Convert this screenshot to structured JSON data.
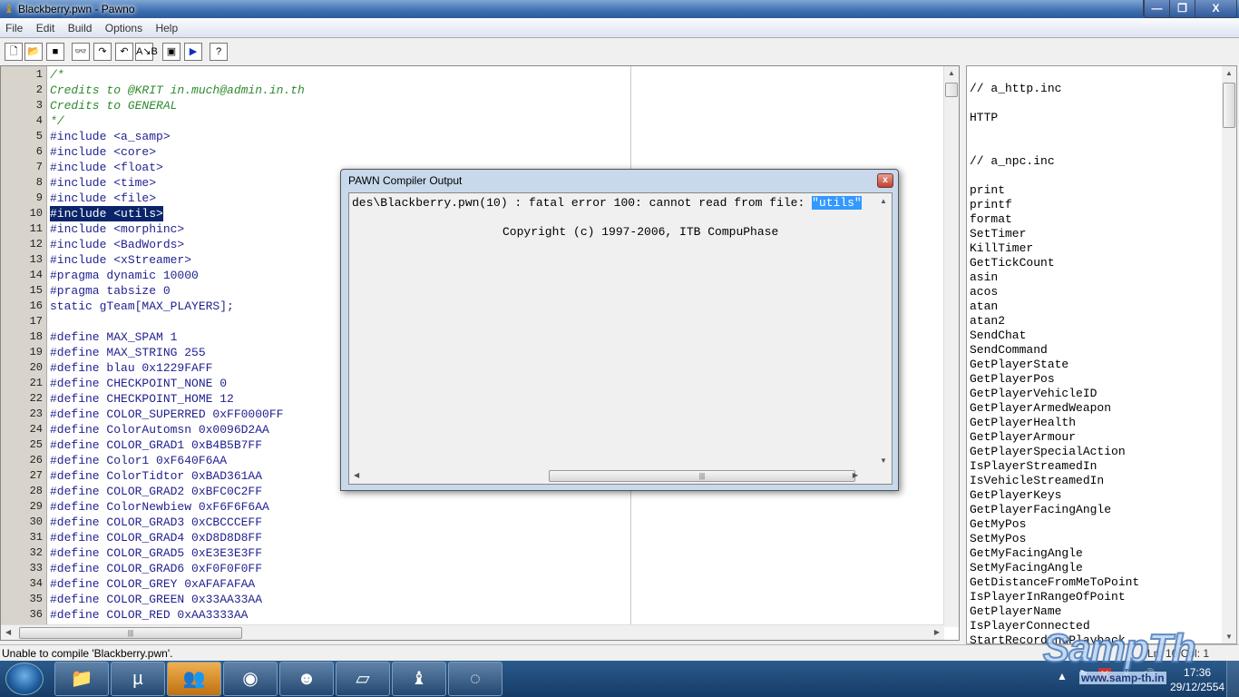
{
  "window": {
    "title": "Blackberry.pwn - Pawno",
    "minimize": "—",
    "maximize": "❐",
    "close": "X"
  },
  "menu": [
    "File",
    "Edit",
    "Build",
    "Options",
    "Help"
  ],
  "toolbar": [
    {
      "name": "new-file",
      "glyph": "🗋"
    },
    {
      "name": "open-file",
      "glyph": "📂"
    },
    {
      "name": "save-file",
      "glyph": "■"
    },
    {
      "name": "find",
      "glyph": "👓"
    },
    {
      "name": "find-next",
      "glyph": "↷"
    },
    {
      "name": "find-prev",
      "glyph": "↶"
    },
    {
      "name": "replace",
      "glyph": "A↘B"
    },
    {
      "name": "compile-window",
      "glyph": "▣"
    },
    {
      "name": "compile-run",
      "glyph": "▶"
    },
    {
      "name": "help",
      "glyph": "?"
    }
  ],
  "editor": {
    "selected_line": 10,
    "lines": [
      {
        "t": "/*",
        "c": "comment"
      },
      {
        "t": "Credits to @KRIT in.much@admin.in.th",
        "c": "comment"
      },
      {
        "t": "Credits to GENERAL",
        "c": "comment"
      },
      {
        "t": "*/",
        "c": "comment"
      },
      {
        "t": "#include <a_samp>"
      },
      {
        "t": "#include <core>"
      },
      {
        "t": "#include <float>"
      },
      {
        "t": "#include <time>"
      },
      {
        "t": "#include <file>"
      },
      {
        "t": "#include <utils>"
      },
      {
        "t": "#include <morphinc>"
      },
      {
        "t": "#include <BadWords>"
      },
      {
        "t": "#include <xStreamer>"
      },
      {
        "t": "#pragma dynamic 10000"
      },
      {
        "t": "#pragma tabsize 0"
      },
      {
        "t": "static gTeam[MAX_PLAYERS];"
      },
      {
        "t": ""
      },
      {
        "t": "#define MAX_SPAM 1"
      },
      {
        "t": "#define MAX_STRING 255"
      },
      {
        "t": "#define blau 0x1229FAFF"
      },
      {
        "t": "#define CHECKPOINT_NONE 0"
      },
      {
        "t": "#define CHECKPOINT_HOME 12"
      },
      {
        "t": "#define COLOR_SUPERRED 0xFF0000FF"
      },
      {
        "t": "#define ColorAutomsn 0x0096D2AA"
      },
      {
        "t": "#define COLOR_GRAD1 0xB4B5B7FF"
      },
      {
        "t": "#define Color1 0xF640F6AA"
      },
      {
        "t": "#define ColorTidtor 0xBAD361AA"
      },
      {
        "t": "#define COLOR_GRAD2 0xBFC0C2FF"
      },
      {
        "t": "#define ColorNewbiew 0xF6F6F6AA"
      },
      {
        "t": "#define COLOR_GRAD3 0xCBCCCEFF"
      },
      {
        "t": "#define COLOR_GRAD4 0xD8D8D8FF"
      },
      {
        "t": "#define COLOR_GRAD5 0xE3E3E3FF"
      },
      {
        "t": "#define COLOR_GRAD6 0xF0F0F0FF"
      },
      {
        "t": "#define COLOR_GREY 0xAFAFAFAA"
      },
      {
        "t": "#define COLOR_GREEN 0x33AA33AA"
      },
      {
        "t": "#define COLOR_RED 0xAA3333AA"
      }
    ]
  },
  "functions_panel": [
    "",
    "// a_http.inc",
    "",
    "HTTP",
    "",
    "",
    "// a_npc.inc",
    "",
    "print",
    "printf",
    "format",
    "SetTimer",
    "KillTimer",
    "GetTickCount",
    "asin",
    "acos",
    "atan",
    "atan2",
    "SendChat",
    "SendCommand",
    "GetPlayerState",
    "GetPlayerPos",
    "GetPlayerVehicleID",
    "GetPlayerArmedWeapon",
    "GetPlayerHealth",
    "GetPlayerArmour",
    "GetPlayerSpecialAction",
    "IsPlayerStreamedIn",
    "IsVehicleStreamedIn",
    "GetPlayerKeys",
    "GetPlayerFacingAngle",
    "GetMyPos",
    "SetMyPos",
    "GetMyFacingAngle",
    "SetMyFacingAngle",
    "GetDistanceFromMeToPoint",
    "IsPlayerInRangeOfPoint",
    "GetPlayerName",
    "IsPlayerConnected",
    "StartRecordingPlayback"
  ],
  "dialog": {
    "title": "PAWN Compiler Output",
    "error_prefix": "des\\Blackberry.pwn(10) : fatal error 100: cannot read from file: ",
    "error_highlight": "\"utils\"",
    "copyright": "Copyright (c) 1997-2006, ITB CompuPhase"
  },
  "status": {
    "message": "Unable to compile 'Blackberry.pwn'.",
    "position": "Ln: 10   Col: 1"
  },
  "taskbar": {
    "apps": [
      {
        "name": "explorer",
        "glyph": "📁"
      },
      {
        "name": "utorrent",
        "glyph": "µ"
      },
      {
        "name": "messenger",
        "glyph": "👥",
        "active": true
      },
      {
        "name": "chrome",
        "glyph": "◉"
      },
      {
        "name": "camfrog",
        "glyph": "☻"
      },
      {
        "name": "notepad",
        "glyph": "▱"
      },
      {
        "name": "pawno",
        "glyph": "♝",
        "open": true
      },
      {
        "name": "loader",
        "glyph": "◌"
      }
    ],
    "time": "17:36",
    "date": "29/12/2554"
  },
  "watermark": {
    "logo": "SampTh",
    "url": "www.samp-th.in"
  }
}
